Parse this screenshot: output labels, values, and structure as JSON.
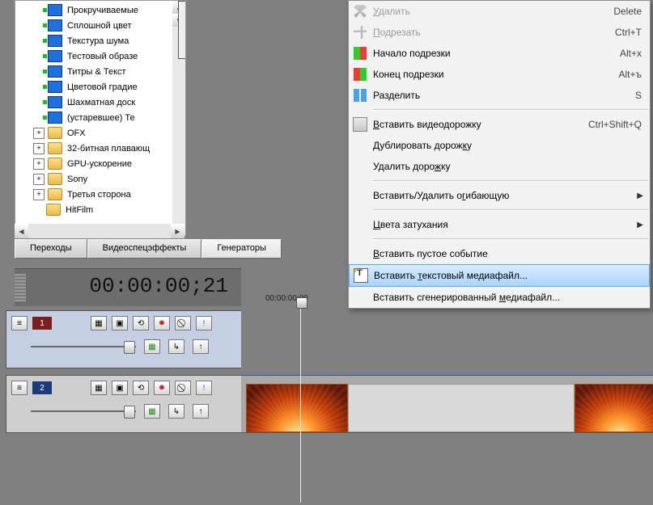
{
  "tree": {
    "generators": [
      "Прокручиваемые",
      "Сплошной цвет",
      "Текстура шума",
      "Тестовый образе",
      "Титры & Текст",
      "Цветовой градие",
      "Шахматная доск",
      "(устаревшее) Те"
    ],
    "folders": [
      "OFX",
      "32-битная плавающ",
      "GPU-ускорение",
      "Sony",
      "Третья сторона",
      "HitFilm"
    ]
  },
  "tabs": {
    "transitions": "Переходы",
    "fx": "Видеоспецэффекты",
    "generators": "Генераторы"
  },
  "timecode": "00:00:00;21",
  "ruler_label": "00:00:00;00",
  "tracks": {
    "t1_num": "1",
    "t2_num": "2"
  },
  "ctx": {
    "delete": "Удалить",
    "delete_sc": "Delete",
    "trim": "Подрезать",
    "trim_sc": "Ctrl+T",
    "trim_start": "Начало подрезки",
    "trim_start_sc": "Alt+х",
    "trim_end": "Конец подрезки",
    "trim_end_sc": "Alt+ъ",
    "split": "Разделить",
    "split_sc": "S",
    "ins_vtrack": "Вставить видеодорожку",
    "ins_vtrack_sc": "Ctrl+Shift+Q",
    "dup_track": "Дублировать дорожку",
    "del_track": "Удалить дорожку",
    "envelopes": "Вставить/Удалить огибающую",
    "fade": "Цвета затухания",
    "empty_event": "Вставить пустое событие",
    "text_media": "Вставить текстовый медиафайл...",
    "gen_media": "Вставить сгенерированный медиафайл..."
  }
}
